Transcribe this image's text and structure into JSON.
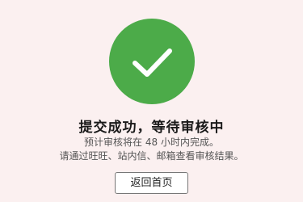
{
  "status": {
    "icon": "checkmark-icon",
    "color": "#4cab49",
    "title": "提交成功，等待审核中",
    "line1": "预计审核将在 48 小时内完成。",
    "line2": "请通过旺旺、站内信、邮箱查看审核结果。"
  },
  "actions": {
    "back_home_label": "返回首页"
  }
}
